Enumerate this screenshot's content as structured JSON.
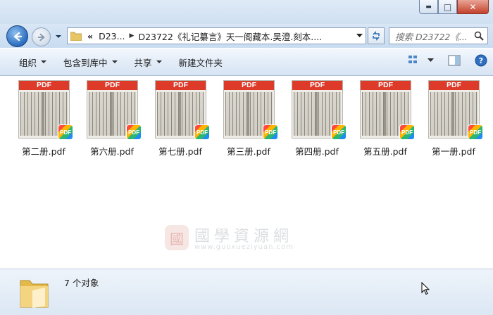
{
  "window": {
    "minimize_glyph": "▬",
    "maximize_glyph": "□",
    "close_glyph": "✕"
  },
  "nav": {
    "breadcrumb": {
      "overflow": "«",
      "parent": "D23...",
      "current": "D23722《礼记纂言》天一阁藏本.吴澄.刻本...."
    },
    "search_placeholder": "搜索 D23722《..."
  },
  "toolbar": {
    "organize": "组织",
    "include_in_library": "包含到库中",
    "share": "共享",
    "new_folder": "新建文件夹"
  },
  "files": [
    {
      "name": "第二册.pdf",
      "band": "PDF",
      "badge": "PDF"
    },
    {
      "name": "第六册.pdf",
      "band": "PDF",
      "badge": "PDF"
    },
    {
      "name": "第七册.pdf",
      "band": "PDF",
      "badge": "PDF"
    },
    {
      "name": "第三册.pdf",
      "band": "PDF",
      "badge": "PDF"
    },
    {
      "name": "第四册.pdf",
      "band": "PDF",
      "badge": "PDF"
    },
    {
      "name": "第五册.pdf",
      "band": "PDF",
      "badge": "PDF"
    },
    {
      "name": "第一册.pdf",
      "band": "PDF",
      "badge": "PDF"
    }
  ],
  "watermark": {
    "seal": "國",
    "title": "國學資源網",
    "url": "www.guoxueziyuan.com"
  },
  "details": {
    "count": "7 个对象"
  },
  "colors": {
    "pdf_red": "#dd3a2a",
    "nav_blue": "#2b6cc0"
  }
}
